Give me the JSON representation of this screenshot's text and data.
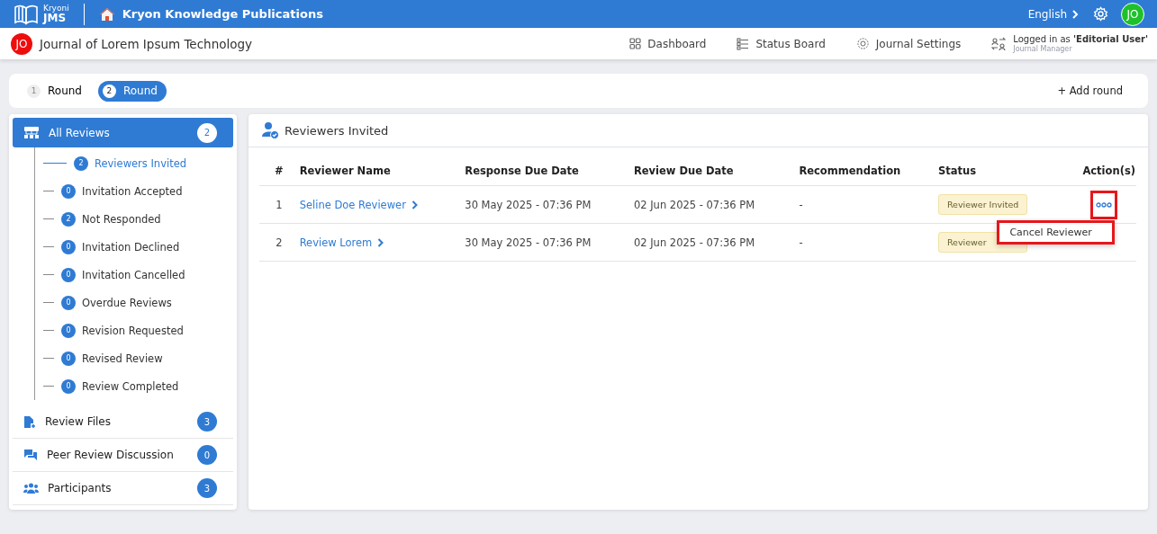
{
  "topbar": {
    "logo_top": "Kryoni",
    "logo_bottom": "JMS",
    "publisher": "Kryon Knowledge Publications",
    "language": "English",
    "avatar": "JO"
  },
  "journal": {
    "avatar": "JO",
    "title": "Journal of Lorem Ipsum Technology"
  },
  "nav": [
    {
      "kind": "dashboard",
      "label": "Dashboard"
    },
    {
      "kind": "status",
      "label": "Status Board"
    },
    {
      "kind": "settings",
      "label": "Journal Settings"
    }
  ],
  "user": {
    "logged_in": "Logged in as **'Editorial User'**",
    "role": "Journal Manager"
  },
  "rounds": [
    {
      "number": "1",
      "label": "Round",
      "selected": false
    },
    {
      "number": "2",
      "label": "Round",
      "selected": true
    }
  ],
  "add_round": "+ Add round",
  "sidebar": {
    "main": {
      "label": "All Reviews",
      "count": "2",
      "selected": true,
      "children": [
        {
          "label": "Reviewers Invited",
          "count": "2",
          "selected": true
        },
        {
          "label": "Invitation Accepted",
          "count": "0",
          "selected": false
        },
        {
          "label": "Not Responded",
          "count": "2",
          "selected": false
        },
        {
          "label": "Invitation Declined",
          "count": "0",
          "selected": false
        },
        {
          "label": "Invitation Cancelled",
          "count": "0",
          "selected": false
        },
        {
          "label": "Overdue Reviews",
          "count": "0",
          "selected": false
        },
        {
          "label": "Revision Requested",
          "count": "0",
          "selected": false
        },
        {
          "label": "Revised Review",
          "count": "0",
          "selected": false
        },
        {
          "label": "Review Completed",
          "count": "0",
          "selected": false
        }
      ]
    },
    "sections": [
      {
        "kind": "files",
        "label": "Review Files",
        "count": "3"
      },
      {
        "kind": "discussion",
        "label": "Peer Review Discussion",
        "count": "0"
      },
      {
        "kind": "participants",
        "label": "Participants",
        "count": "3"
      }
    ]
  },
  "panel": {
    "title": "Reviewers Invited",
    "columns": [
      "#",
      "Reviewer Name",
      "Response Due Date",
      "Review Due Date",
      "Recommendation",
      "Status",
      "Action(s)"
    ],
    "rows": [
      {
        "number": "1",
        "name": "Seline Doe Reviewer",
        "response_due": "30 May 2025 - 07:36 PM",
        "review_due": "02 Jun 2025 - 07:36 PM",
        "recommendation": "-",
        "status": "Reviewer Invited",
        "highlighted": true,
        "menu_open": true
      },
      {
        "number": "2",
        "name": "Review Lorem",
        "response_due": "30 May 2025 - 07:36 PM",
        "review_due": "02 Jun 2025 - 07:36 PM",
        "recommendation": "-",
        "status": "Reviewer",
        "menu_open": false
      }
    ],
    "menu": {
      "items": [
        "Cancel Reviewer"
      ],
      "highlighted": true
    }
  }
}
